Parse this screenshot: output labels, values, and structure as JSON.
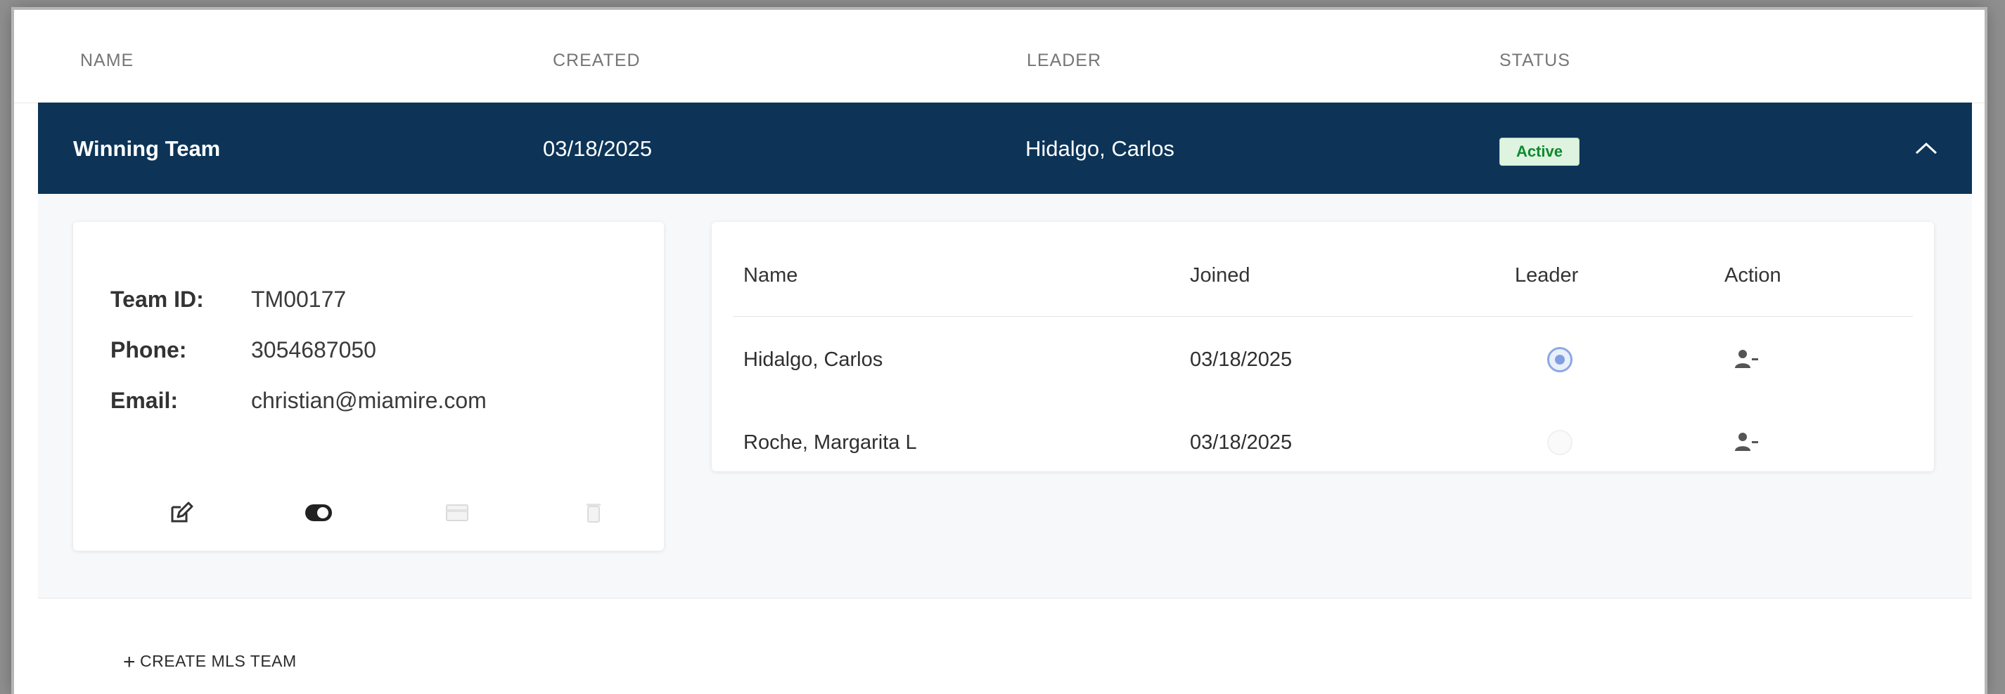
{
  "columns": {
    "name": "NAME",
    "created": "CREATED",
    "leader": "LEADER",
    "status": "STATUS"
  },
  "team": {
    "name": "Winning Team",
    "created": "03/18/2025",
    "leader": "Hidalgo, Carlos",
    "status": "Active",
    "row_color": "#0d3457",
    "status_color": "#0e8a2d"
  },
  "details": {
    "team_id_label": "Team ID:",
    "team_id": "TM00177",
    "phone_label": "Phone:",
    "phone": "3054687050",
    "email_label": "Email:",
    "email": "christian@miamire.com",
    "actions": [
      "edit-icon",
      "toggle-icon",
      "card-icon",
      "trash-icon"
    ]
  },
  "members": {
    "headers": {
      "name": "Name",
      "joined": "Joined",
      "leader": "Leader",
      "action": "Action"
    },
    "rows": [
      {
        "name": "Hidalgo, Carlos",
        "joined": "03/18/2025",
        "is_leader": true,
        "action_icon": "remove-user-icon"
      },
      {
        "name": "Roche, Margarita L",
        "joined": "03/18/2025",
        "is_leader": false,
        "action_icon": "remove-user-icon"
      }
    ]
  },
  "create_button": {
    "label": "CREATE MLS TEAM",
    "icon": "plus-icon"
  }
}
